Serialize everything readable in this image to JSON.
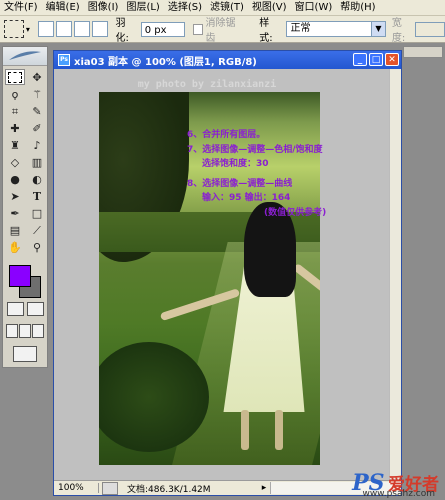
{
  "menubar": {
    "items": [
      "文件(F)",
      "编辑(E)",
      "图像(I)",
      "图层(L)",
      "选择(S)",
      "滤镜(T)",
      "视图(V)",
      "窗口(W)",
      "帮助(H)"
    ]
  },
  "options_bar": {
    "feather_label": "羽化:",
    "feather_value": "0 px",
    "antialias_label": "消除锯齿",
    "style_label": "样式:",
    "style_value": "正常",
    "width_label": "宽度:"
  },
  "document": {
    "title": "xia03 副本 @ 100% (图层1, RGB/8)",
    "zoom": "100%",
    "doc_size": "文档:486.3K/1.42M",
    "overlay_top": "my photo by zilanxianzi",
    "notes": [
      "6、合并所有图层。",
      "7、选择图像—调整—色相/饱和度",
      "选择饱和度：30",
      "8、选择图像—调整—曲线",
      "输入：95  输出：164",
      "(数值仅供参考)"
    ]
  },
  "colors": {
    "foreground": "#8a00ff",
    "background": "#6e6e6e",
    "note_text": "#8a1fd1",
    "title_bar": "#2357d0"
  },
  "toolbox": {
    "tools": [
      "marquee-icon",
      "move-icon",
      "lasso-icon",
      "magic-wand-icon",
      "crop-icon",
      "slice-icon",
      "healing-icon",
      "brush-icon",
      "stamp-icon",
      "history-brush-icon",
      "eraser-icon",
      "gradient-icon",
      "blur-icon",
      "dodge-icon",
      "path-select-icon",
      "type-icon",
      "pen-icon",
      "shape-icon",
      "notes-icon",
      "eyedropper-icon",
      "hand-icon",
      "zoom-icon"
    ]
  },
  "watermark": {
    "brand": "PS",
    "brand_cn": "爱好者",
    "url": "www.psahz.com"
  }
}
